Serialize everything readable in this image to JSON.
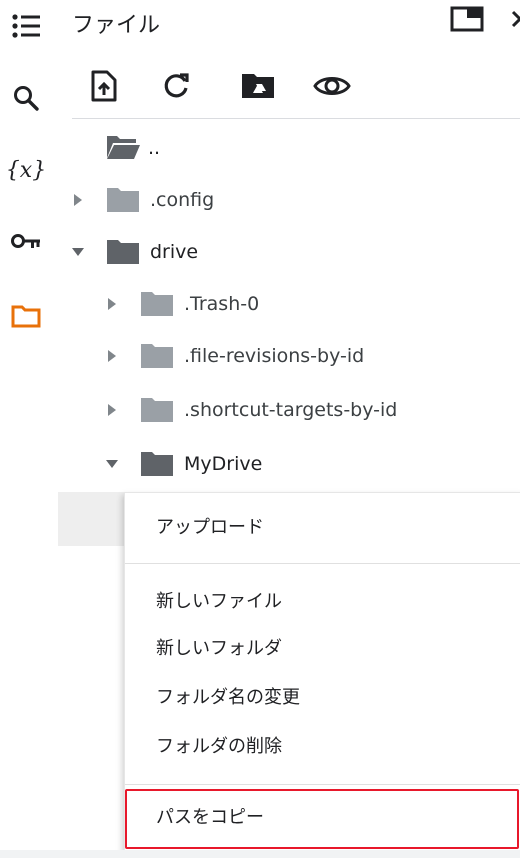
{
  "panel": {
    "title": "ファイル"
  },
  "rail": {
    "items": [
      {
        "icon": "table-of-contents-icon"
      },
      {
        "icon": "search-icon"
      },
      {
        "icon": "variables-icon",
        "glyph": "{x}"
      },
      {
        "icon": "key-icon"
      },
      {
        "icon": "folder-icon",
        "active_color": "#e8710a"
      }
    ]
  },
  "toolbar": {
    "buttons": [
      {
        "icon": "upload-file-icon"
      },
      {
        "icon": "refresh-icon"
      },
      {
        "icon": "mount-drive-icon"
      },
      {
        "icon": "show-hidden-files-icon"
      }
    ]
  },
  "tree": {
    "items": [
      {
        "label": "..",
        "state": "none"
      },
      {
        "label": ".config",
        "state": "collapsed"
      },
      {
        "label": "drive",
        "state": "expanded"
      },
      {
        "label": ".Trash-0",
        "state": "collapsed"
      },
      {
        "label": ".file-revisions-by-id",
        "state": "collapsed"
      },
      {
        "label": ".shortcut-targets-by-id",
        "state": "collapsed"
      },
      {
        "label": "MyDrive",
        "state": "expanded"
      }
    ]
  },
  "context_menu": {
    "upload": "アップロード",
    "new_file": "新しいファイル",
    "new_folder": "新しいフォルダ",
    "rename_folder": "フォルダ名の変更",
    "delete_folder": "フォルダの削除",
    "copy_path": "パスをコピー"
  },
  "colors": {
    "accent_orange": "#e8710a",
    "highlight_red": "#e8182b",
    "folder_dark": "#5f6368",
    "folder_light": "#9aa0a6"
  }
}
